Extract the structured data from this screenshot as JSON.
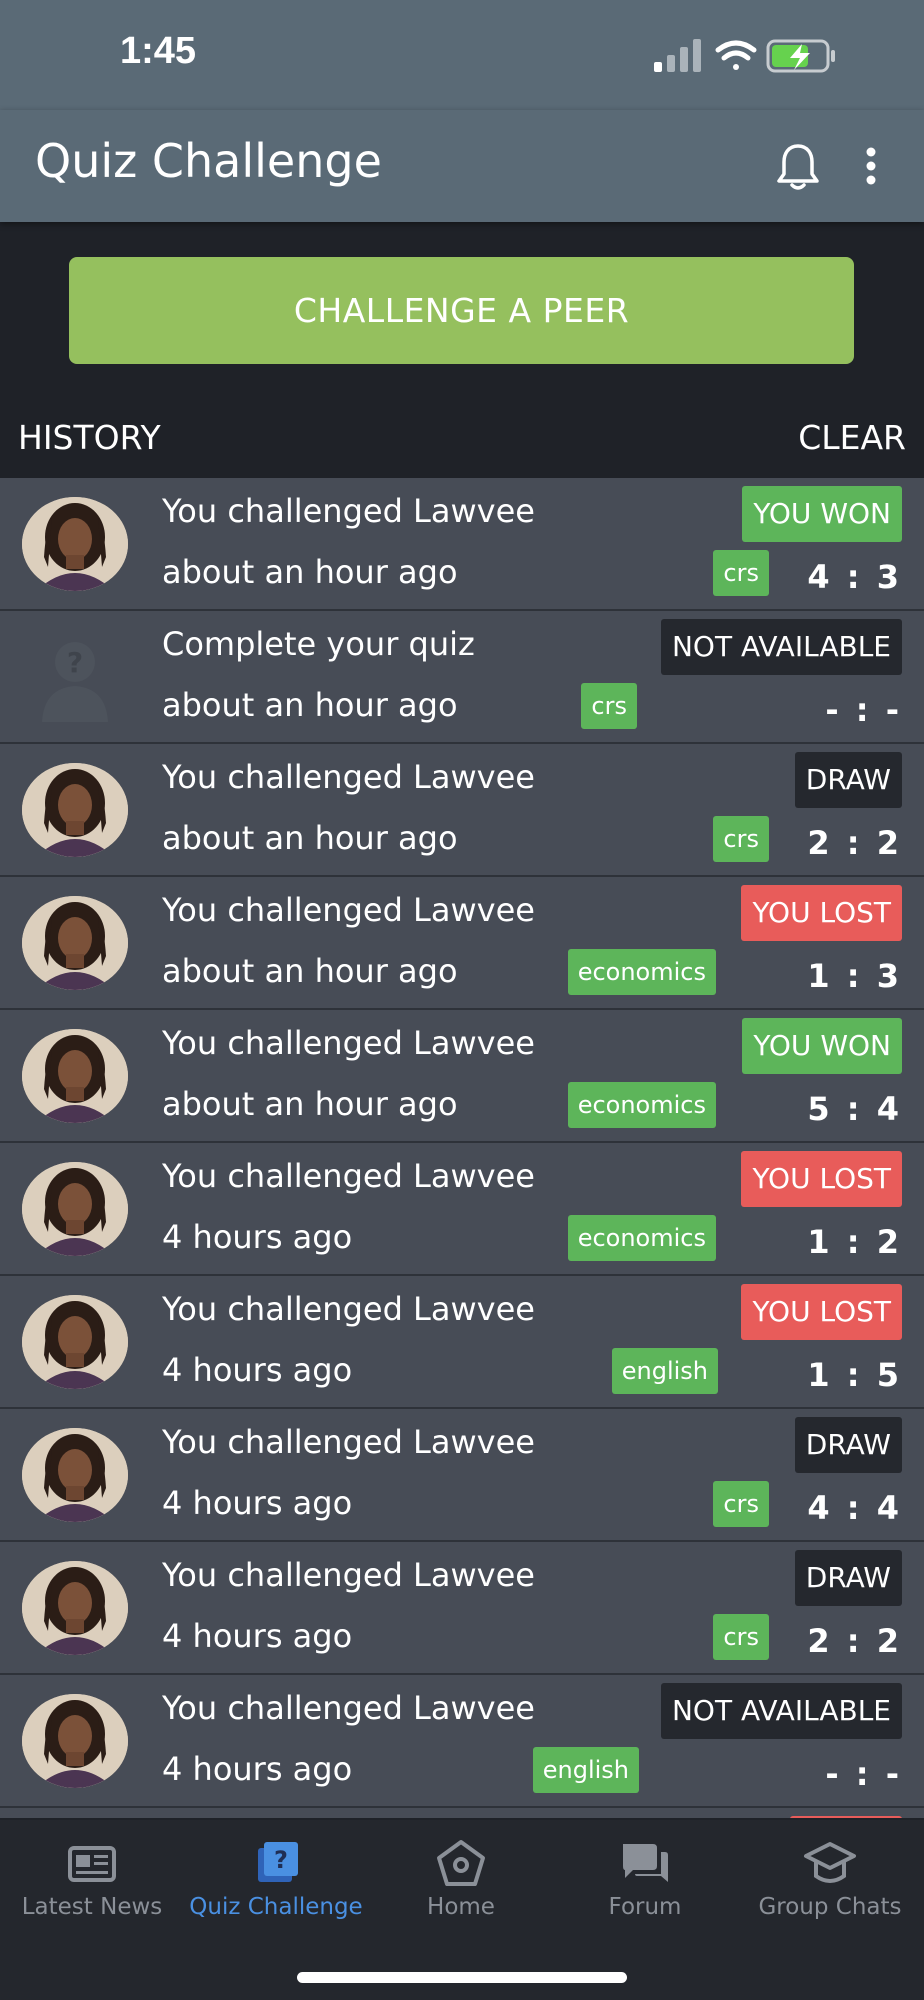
{
  "status_bar": {
    "time": "1:45"
  },
  "header": {
    "title": "Quiz Challenge"
  },
  "challenge_button": "CHALLENGE A PEER",
  "history": {
    "label": "HISTORY",
    "clear": "CLEAR"
  },
  "items": [
    {
      "title": "You challenged Lawvee",
      "time": "about an hour ago",
      "subject": "crs",
      "result": "YOU WON",
      "result_type": "won",
      "score": "4 : 3",
      "avatar": "photo"
    },
    {
      "title": "Complete your quiz",
      "time": "about an hour ago",
      "subject": "crs",
      "result": "NOT AVAILABLE",
      "result_type": "neutral",
      "score": "- : -",
      "avatar": "placeholder"
    },
    {
      "title": "You challenged Lawvee",
      "time": "about an hour ago",
      "subject": "crs",
      "result": "DRAW",
      "result_type": "neutral",
      "score": "2 : 2",
      "avatar": "photo"
    },
    {
      "title": "You challenged Lawvee",
      "time": "about an hour ago",
      "subject": "economics",
      "result": "YOU LOST",
      "result_type": "lost",
      "score": "1 : 3",
      "avatar": "photo"
    },
    {
      "title": "You challenged Lawvee",
      "time": "about an hour ago",
      "subject": "economics",
      "result": "YOU WON",
      "result_type": "won",
      "score": "5 : 4",
      "avatar": "photo"
    },
    {
      "title": "You challenged Lawvee",
      "time": "4 hours ago",
      "subject": "economics",
      "result": "YOU LOST",
      "result_type": "lost",
      "score": "1 : 2",
      "avatar": "photo"
    },
    {
      "title": "You challenged Lawvee",
      "time": "4 hours ago",
      "subject": "english",
      "result": "YOU LOST",
      "result_type": "lost",
      "score": "1 : 5",
      "avatar": "photo"
    },
    {
      "title": "You challenged Lawvee",
      "time": "4 hours ago",
      "subject": "crs",
      "result": "DRAW",
      "result_type": "neutral",
      "score": "4 : 4",
      "avatar": "photo"
    },
    {
      "title": "You challenged Lawvee",
      "time": "4 hours ago",
      "subject": "crs",
      "result": "DRAW",
      "result_type": "neutral",
      "score": "2 : 2",
      "avatar": "photo"
    },
    {
      "title": "You challenged Lawvee",
      "time": "4 hours ago",
      "subject": "english",
      "result": "NOT AVAILABLE",
      "result_type": "neutral",
      "score": "- : -",
      "avatar": "photo"
    }
  ],
  "bottom_nav": [
    {
      "label": "Latest News",
      "icon": "newspaper-icon"
    },
    {
      "label": "Quiz Challenge",
      "icon": "quiz-icon"
    },
    {
      "label": "Home",
      "icon": "home-icon"
    },
    {
      "label": "Forum",
      "icon": "forum-icon"
    },
    {
      "label": "Group Chats",
      "icon": "group-chats-icon"
    }
  ],
  "colors": {
    "header": "#5a6a76",
    "accent": "#95c05e",
    "tag": "#5db55a",
    "won": "#5db55a",
    "lost": "#e85c5a",
    "active_nav": "#4a90e2"
  }
}
